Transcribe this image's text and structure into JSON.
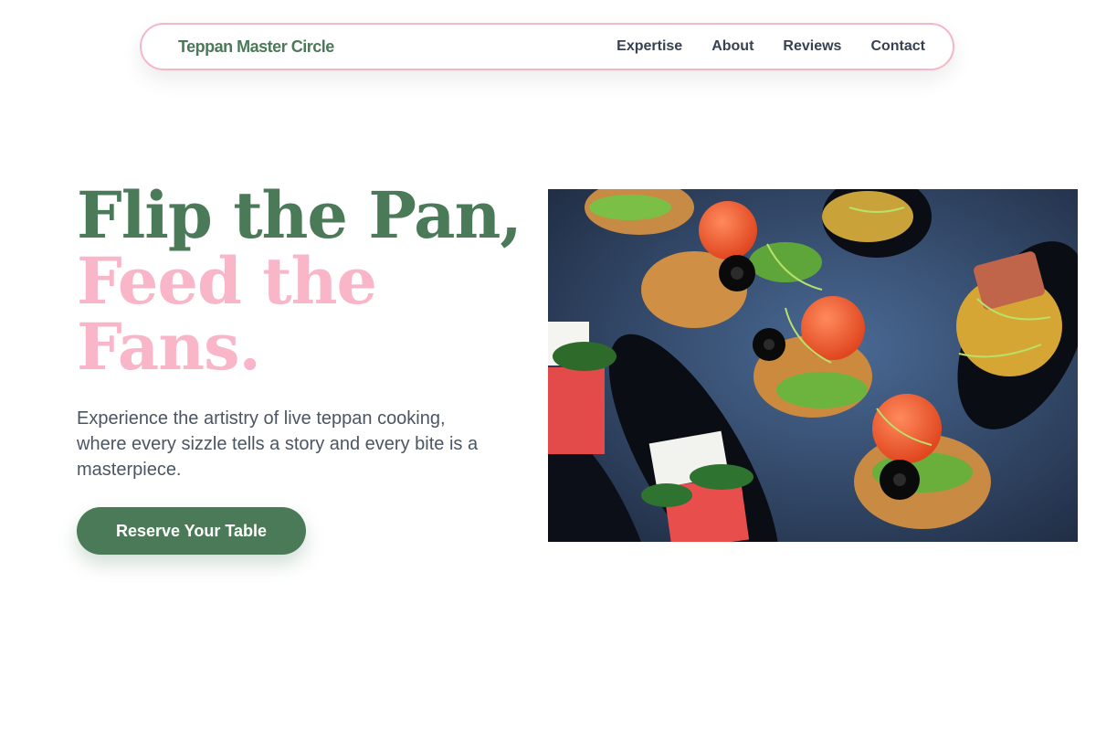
{
  "nav": {
    "brand": "Teppan Master Circle",
    "links": [
      {
        "label": "Expertise"
      },
      {
        "label": "About"
      },
      {
        "label": "Reviews"
      },
      {
        "label": "Contact"
      }
    ]
  },
  "hero": {
    "title_line1": "Flip the Pan,",
    "title_line2": "Feed the",
    "title_line3": "Fans.",
    "description": "Experience the artistry of live teppan cooking, where every sizzle tells a story and every bite is a masterpiece.",
    "cta_label": "Reserve Your Table"
  },
  "colors": {
    "primary_green": "#4a7a57",
    "accent_pink": "#f9b6c8",
    "nav_border": "#f5b6c6",
    "text_dark": "#374151"
  }
}
